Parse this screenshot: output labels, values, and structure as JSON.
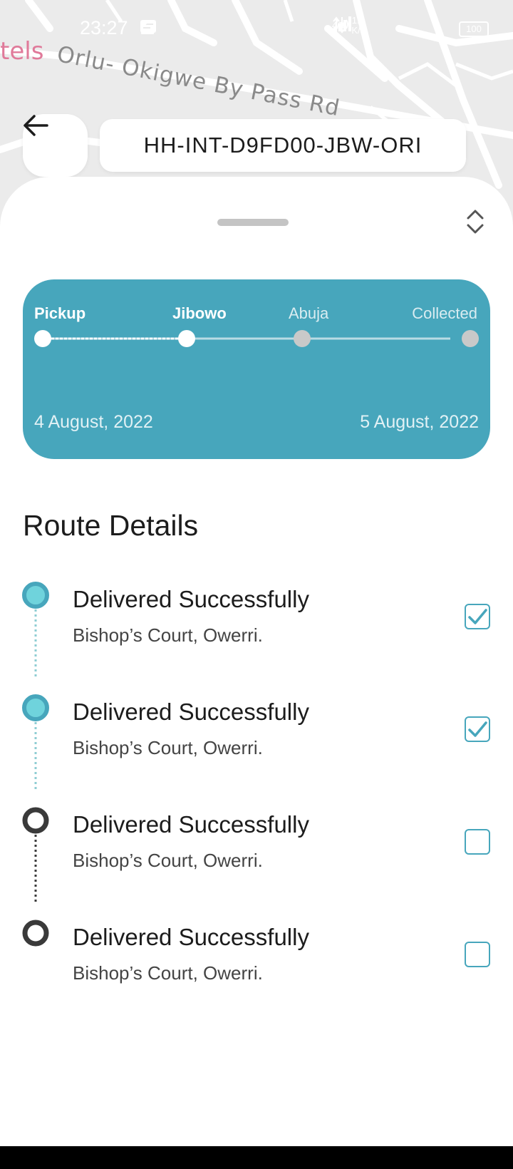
{
  "status_bar": {
    "time": "23:27",
    "network_type": "4G",
    "net_speed_value": "1.3",
    "net_speed_unit": "K/s",
    "battery": "100"
  },
  "map": {
    "place_label": "tels",
    "road_label": "Orlu- Okigwe By Pass Rd"
  },
  "header": {
    "tracking_code": "HH-INT-D9FD00-JBW-ORI"
  },
  "progress": {
    "stages": [
      {
        "label": "Pickup",
        "reached": true
      },
      {
        "label": "Jibowo",
        "reached": true
      },
      {
        "label": "Abuja",
        "reached": false
      },
      {
        "label": "Collected",
        "reached": false
      }
    ],
    "start_date": "4  August, 2022",
    "end_date": "5  August, 2022"
  },
  "route_details": {
    "title": "Route Details",
    "items": [
      {
        "status": "Delivered Successfully",
        "address": "Bishop’s Court, Owerri.",
        "checked": true
      },
      {
        "status": "Delivered Successfully",
        "address": "Bishop’s Court, Owerri.",
        "checked": true
      },
      {
        "status": "Delivered Successfully",
        "address": "Bishop’s Court, Owerri.",
        "checked": false
      },
      {
        "status": "Delivered Successfully",
        "address": "Bishop’s Court, Owerri.",
        "checked": false
      }
    ]
  },
  "colors": {
    "accent": "#47a6bc",
    "completed_dot": "#6fd3dc",
    "pending_dot": "#3a3a3a",
    "map_background": "#ebebeb"
  }
}
